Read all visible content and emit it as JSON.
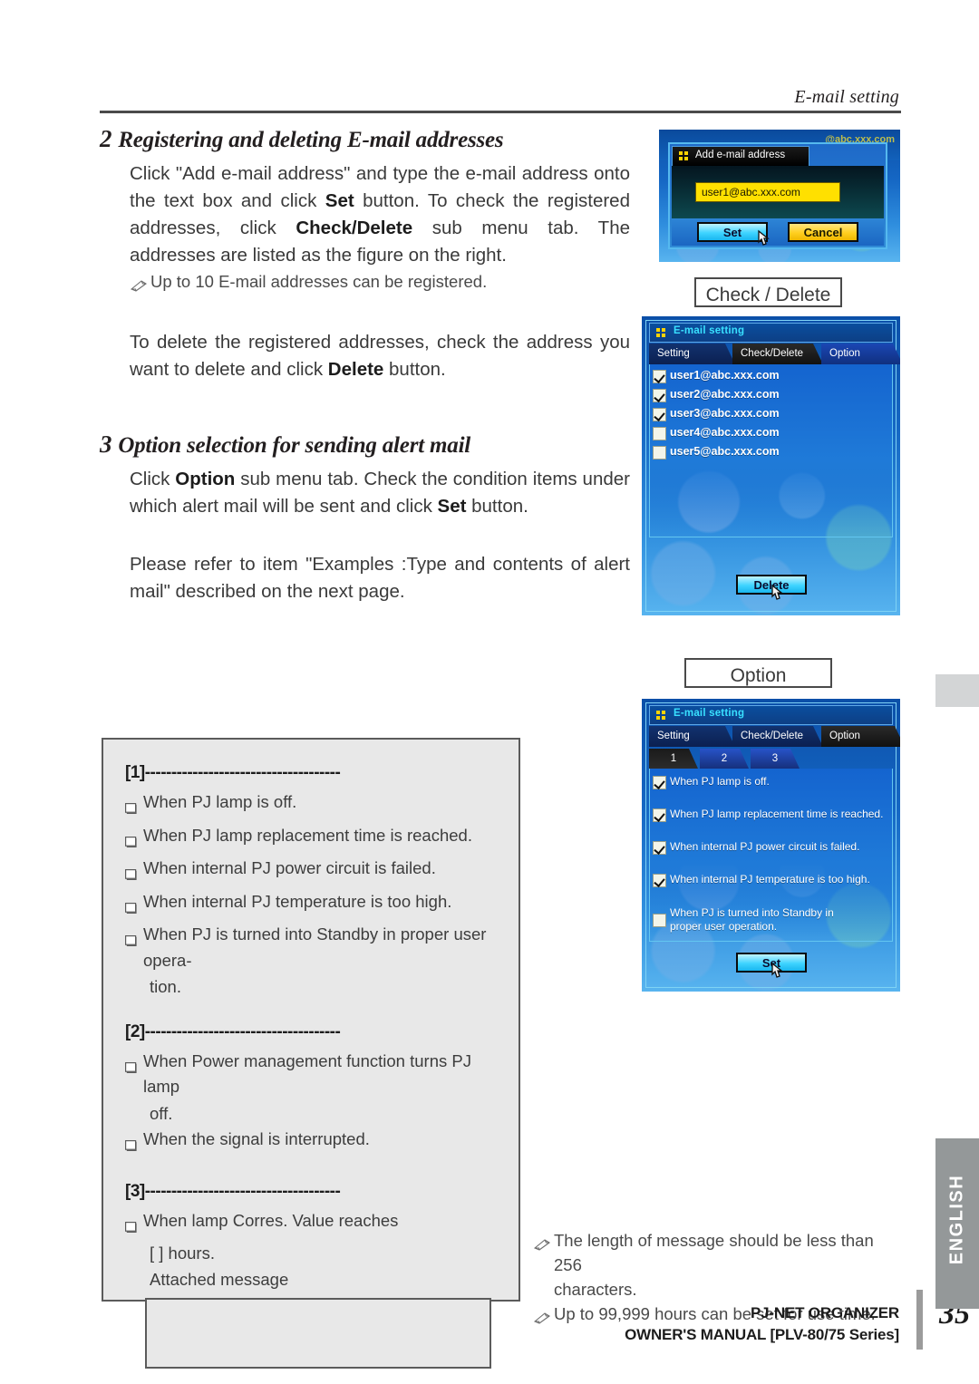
{
  "header": {
    "running_title": "E-mail setting"
  },
  "steps": [
    {
      "num": "2",
      "title": "Registering and deleting E-mail addresses",
      "body_html": "Click \"Add e-mail address\" and type the e-mail address onto the text box and click <b>Set</b> button. To check the registered addresses, click <b>Check/Delete</b> sub menu tab. The addresses are listed as the figure on the right.",
      "note": "Up to 10 E-mail addresses can be registered.",
      "body2_html": "To delete the registered addresses, check the address you want to delete and click <b>Delete</b> button."
    },
    {
      "num": "3",
      "title": "Option selection for sending alert mail",
      "body_html": "Click <b>Option</b> sub menu tab. Check the condition items under which alert mail will be sent and click <b>Set</b> button.",
      "body2_html": "Please refer to item \"Examples :Type and contents of alert mail\" described on the next page."
    }
  ],
  "conditions": {
    "group1": {
      "title": "[1]-------------------------------------",
      "items": [
        "When PJ lamp is off.",
        "When PJ lamp replacement time is reached.",
        "When internal PJ power circuit is failed.",
        "When internal PJ temperature is too high.",
        "When PJ is turned into Standby in proper user opera-"
      ],
      "continuation": "tion."
    },
    "group2": {
      "title": "[2]-------------------------------------",
      "items": [
        "When Power management function turns PJ lamp",
        "When the signal is interrupted."
      ],
      "continuation": "off."
    },
    "group3": {
      "title": "[3]-------------------------------------",
      "items": [
        "When lamp Corres. Value reaches"
      ],
      "hours_line": "[      ] hours.",
      "attached_label": "Attached message",
      "attached_value": ""
    }
  },
  "shots": {
    "add_address": {
      "background_text": "@abc.xxx.com",
      "dialog_title": "Add e-mail address",
      "input_value": "user1@abc.xxx.com",
      "set_label": "Set",
      "cancel_label": "Cancel"
    },
    "check_delete": {
      "caption": "Check / Delete",
      "window_title": "E-mail setting",
      "tabs": [
        {
          "label": "Setting",
          "active": false
        },
        {
          "label": "Check/Delete",
          "active": true
        },
        {
          "label": "Option",
          "active": false
        }
      ],
      "addresses": [
        {
          "label": "user1@abc.xxx.com",
          "checked": true
        },
        {
          "label": "user2@abc.xxx.com",
          "checked": true
        },
        {
          "label": "user3@abc.xxx.com",
          "checked": true
        },
        {
          "label": "user4@abc.xxx.com",
          "checked": false
        },
        {
          "label": "user5@abc.xxx.com",
          "checked": false
        }
      ],
      "delete_label": "Delete"
    },
    "option": {
      "caption": "Option",
      "window_title": "E-mail setting",
      "tabs": [
        {
          "label": "Setting",
          "active": false
        },
        {
          "label": "Check/Delete",
          "active": false
        },
        {
          "label": "Option",
          "active": true
        }
      ],
      "number_tabs": [
        {
          "label": "1",
          "active": true
        },
        {
          "label": "2",
          "active": false
        },
        {
          "label": "3",
          "active": false
        }
      ],
      "conditions": [
        {
          "label": "When PJ lamp is off.",
          "checked": true
        },
        {
          "label": "When PJ lamp replacement time is reached.",
          "checked": true
        },
        {
          "label": "When internal PJ power circuit is failed.",
          "checked": true
        },
        {
          "label": "When internal PJ temperature is too high.",
          "checked": true
        },
        {
          "label": "When PJ is turned into Standby in",
          "label2": "proper user operation.",
          "checked": false
        }
      ],
      "set_label": "Set"
    }
  },
  "bottom_notes": [
    {
      "line1": "The length of message should be less than 256",
      "line2": "characters."
    },
    {
      "line1": "Up to 99,999 hours can be set for use time.",
      "line2": ""
    }
  ],
  "footer": {
    "line1": "PJ-NET ORGANIZER",
    "line2": "OWNER'S MANUAL [PLV-80/75 Series]",
    "page_number": "35"
  },
  "side_tab": {
    "language": "ENGLISH"
  },
  "colors": {
    "rule": "#4a4a4a",
    "box_bg": "#e8e8e8",
    "osd_blue": "#1567c4",
    "osd_cyan": "#39e0ff",
    "input_yellow": "#ffe000",
    "side_tab_gray": "#949899"
  }
}
